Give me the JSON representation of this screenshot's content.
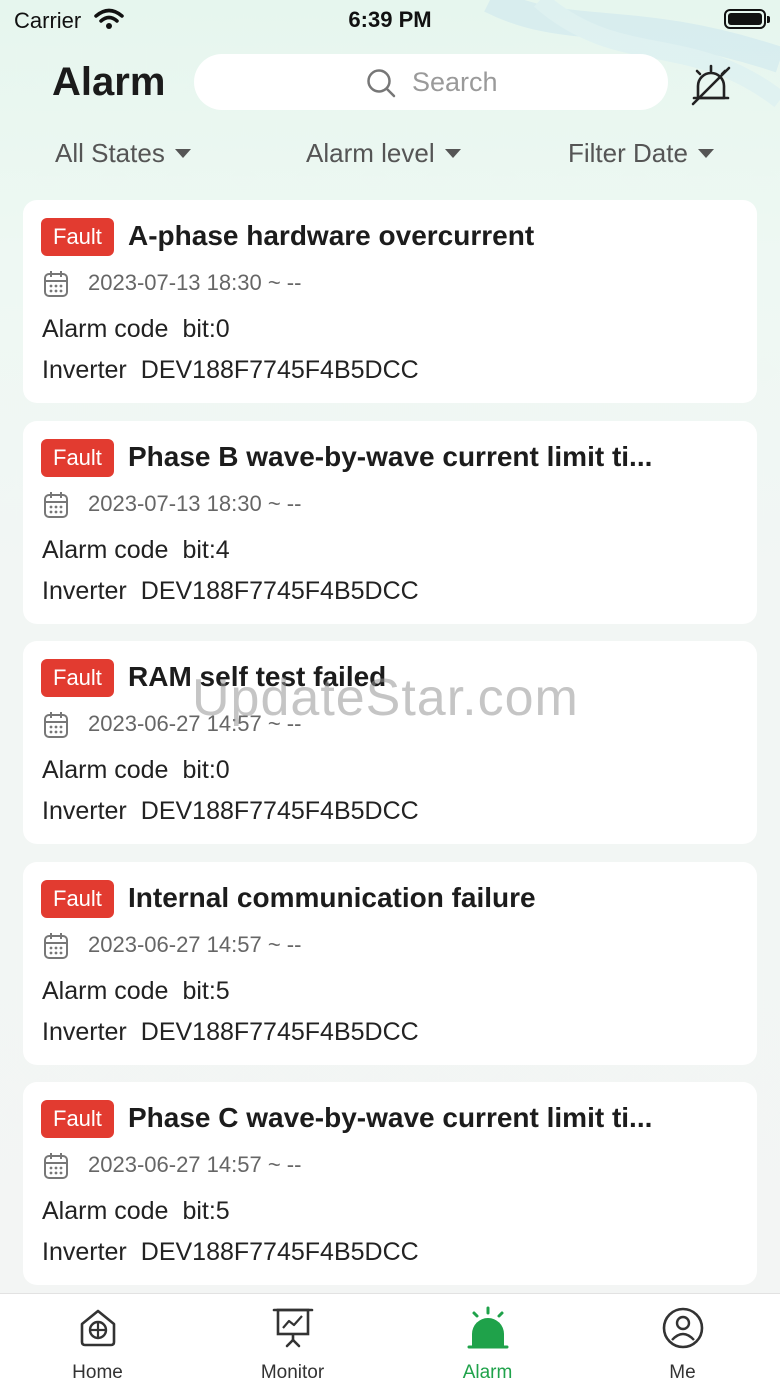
{
  "status_bar": {
    "carrier": "Carrier",
    "time": "6:39 PM"
  },
  "header": {
    "title": "Alarm",
    "search_placeholder": "Search"
  },
  "filters": {
    "states": "All States",
    "level": "Alarm level",
    "date": "Filter Date"
  },
  "alarms": [
    {
      "level": "Fault",
      "title": "A-phase hardware overcurrent",
      "time": "2023-07-13 18:30  ~  --",
      "code_label": "Alarm code",
      "code": "bit:0",
      "device_label": "Inverter",
      "device": "DEV188F7745F4B5DCC"
    },
    {
      "level": "Fault",
      "title": "Phase B wave-by-wave current limit ti...",
      "time": "2023-07-13 18:30  ~  --",
      "code_label": "Alarm code",
      "code": "bit:4",
      "device_label": "Inverter",
      "device": "DEV188F7745F4B5DCC"
    },
    {
      "level": "Fault",
      "title": "RAM self test failed",
      "time": "2023-06-27 14:57  ~  --",
      "code_label": "Alarm code",
      "code": "bit:0",
      "device_label": "Inverter",
      "device": "DEV188F7745F4B5DCC"
    },
    {
      "level": "Fault",
      "title": "Internal communication failure",
      "time": "2023-06-27 14:57  ~  --",
      "code_label": "Alarm code",
      "code": "bit:5",
      "device_label": "Inverter",
      "device": "DEV188F7745F4B5DCC"
    },
    {
      "level": "Fault",
      "title": "Phase C wave-by-wave current limit ti...",
      "time": "2023-06-27 14:57  ~  --",
      "code_label": "Alarm code",
      "code": "bit:5",
      "device_label": "Inverter",
      "device": "DEV188F7745F4B5DCC"
    }
  ],
  "watermark": "UpdateStar.com",
  "tabs": [
    {
      "label": "Home",
      "icon": "home-icon"
    },
    {
      "label": "Monitor",
      "icon": "monitor-icon"
    },
    {
      "label": "Alarm",
      "icon": "alarm-icon",
      "active": true
    },
    {
      "label": "Me",
      "icon": "user-icon"
    }
  ],
  "colors": {
    "accent": "#1fa24a",
    "fault": "#e23b30"
  }
}
